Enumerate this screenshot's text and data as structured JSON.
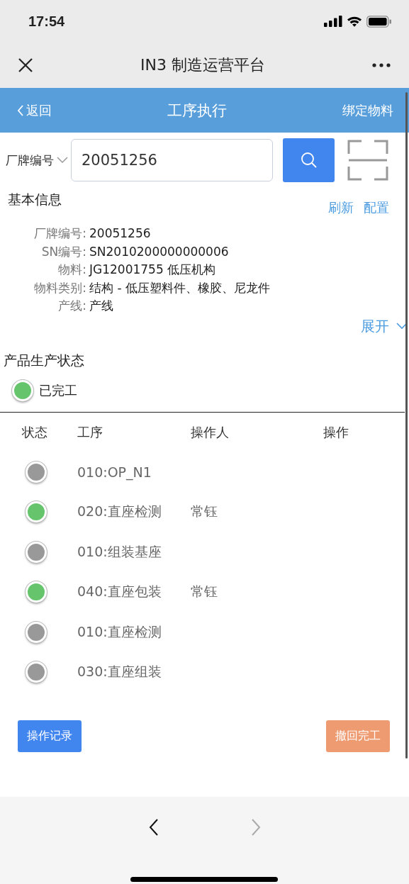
{
  "status_bar": {
    "time": "17:54"
  },
  "browser": {
    "title": "IN3 制造运营平台"
  },
  "header": {
    "back": "返回",
    "title": "工序执行",
    "action": "绑定物料"
  },
  "search": {
    "field_type": "厂牌编号",
    "value": "20051256"
  },
  "basic_info": {
    "title": "基本信息",
    "actions": [
      "刷新",
      "配置"
    ],
    "fields": [
      {
        "label": "厂牌编号:",
        "value": "20051256"
      },
      {
        "label": "SN编号:",
        "value": "SN2010200000000006"
      },
      {
        "label": "物料:",
        "value": "JG12001755 低压机构"
      },
      {
        "label": "物料类别:",
        "value": "结构 - 低压塑料件、橡胶、尼龙件"
      },
      {
        "label": "产线:",
        "value": "产线"
      }
    ],
    "expand": "展开"
  },
  "production_status": {
    "title": "产品生产状态",
    "done": true,
    "label": "已完工"
  },
  "table": {
    "columns": [
      "状态",
      "工序",
      "操作人",
      "操作"
    ],
    "rows": [
      {
        "done": false,
        "step": "010:OP_N1"
      },
      {
        "done": true,
        "step": "020:直座检测",
        "operator": "常钰"
      },
      {
        "done": false,
        "step": "010:组装基座"
      },
      {
        "done": true,
        "step": "040:直座包装",
        "operator": "常钰"
      },
      {
        "done": false,
        "step": "010:直座检测"
      },
      {
        "done": false,
        "step": "030:直座组装"
      }
    ]
  },
  "buttons": [
    {
      "label": "操作记录",
      "kind": "primary"
    },
    {
      "label": "撤回完工",
      "kind": "warning"
    }
  ],
  "browser_nav": {
    "back_disabled": false,
    "forward_disabled": true
  }
}
